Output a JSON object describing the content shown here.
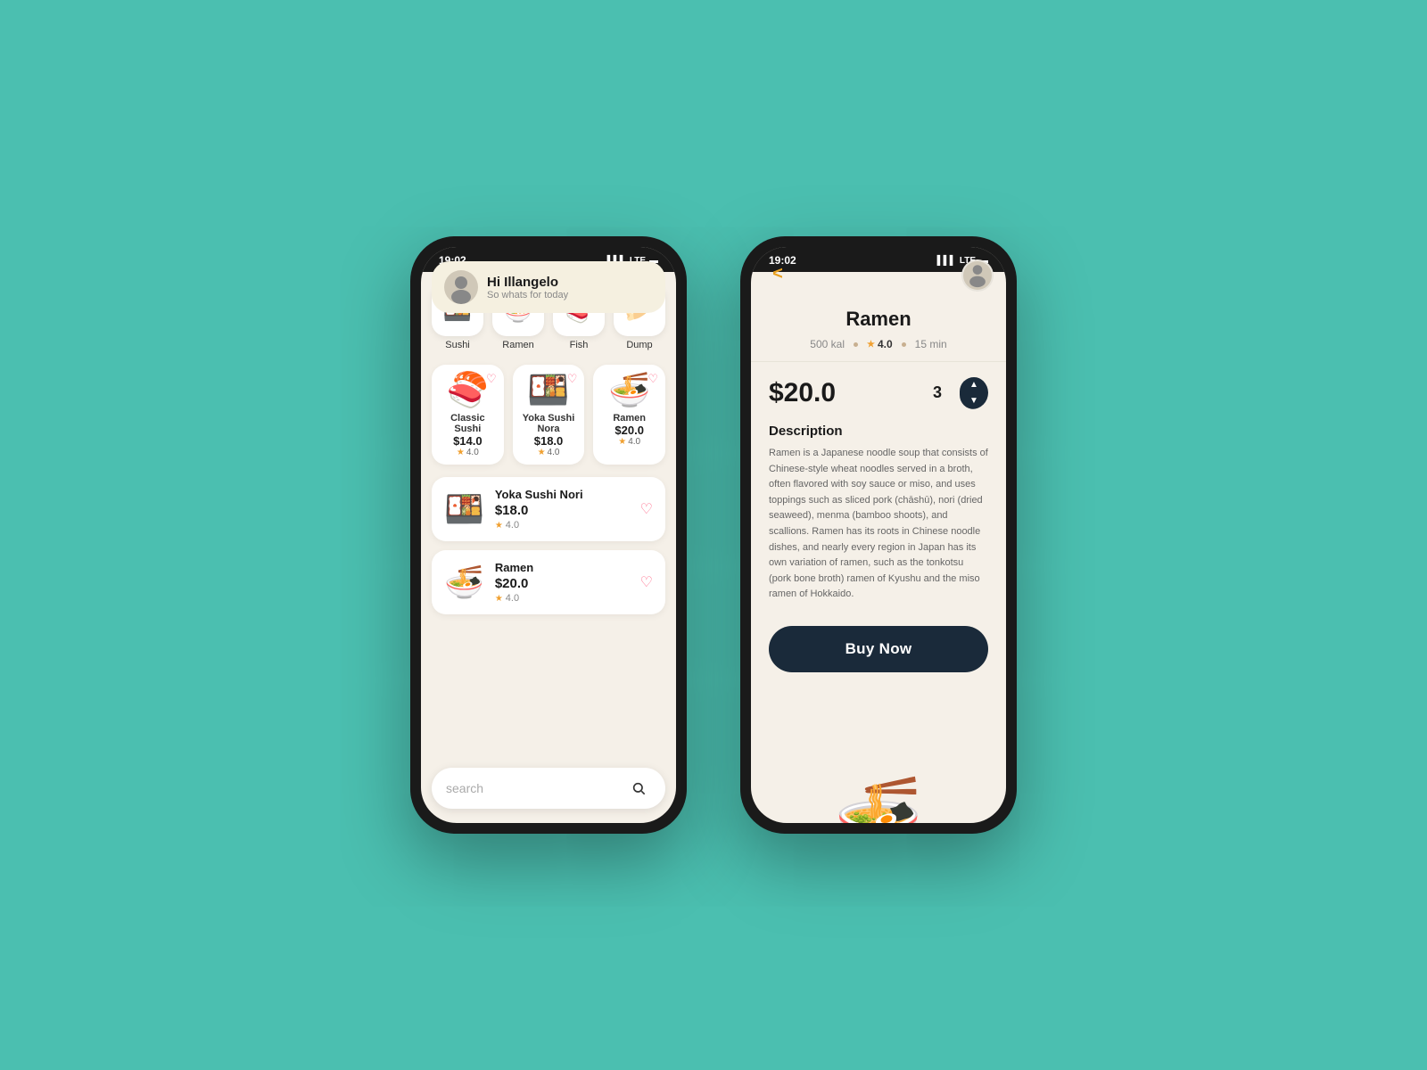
{
  "background_color": "#4BBFB0",
  "phone1": {
    "status_bar": {
      "time": "19:02",
      "signal": "▌▌▌",
      "network": "LTE",
      "battery": "🔋"
    },
    "greeting": {
      "title": "Hi Illangelo",
      "subtitle": "So whats for today"
    },
    "search": {
      "placeholder": "search"
    },
    "categories": [
      {
        "label": "Sushi",
        "emoji": "🍱"
      },
      {
        "label": "Ramen",
        "emoji": "🍜"
      },
      {
        "label": "Fish",
        "emoji": "🍣"
      },
      {
        "label": "Dump",
        "emoji": "🥟"
      }
    ],
    "featured_items": [
      {
        "name": "Classic Sushi",
        "price": "$14.0",
        "rating": "4.0",
        "emoji": "🍣"
      },
      {
        "name": "Yoka Sushi Nora",
        "price": "$18.0",
        "rating": "4.0",
        "emoji": "🍱"
      },
      {
        "name": "Ramen",
        "price": "$20.0",
        "rating": "4.0",
        "emoji": "🍜"
      }
    ],
    "list_items": [
      {
        "name": "Yoka Sushi Nori",
        "price": "$18.0",
        "rating": "4.0",
        "emoji": "🍱"
      },
      {
        "name": "Ramen",
        "price": "$20.0",
        "rating": "4.0",
        "emoji": "🍜"
      }
    ]
  },
  "phone2": {
    "status_bar": {
      "time": "19:02",
      "signal": "▌▌▌",
      "network": "LTE",
      "battery": "🔋"
    },
    "item": {
      "name": "Ramen",
      "emoji": "🍜",
      "calories": "500 kal",
      "rating": "4.0",
      "time": "15 min",
      "price": "$20.0",
      "quantity": "3",
      "description_title": "Description",
      "description": "Ramen is a Japanese noodle soup that consists of Chinese-style wheat noodles served in a broth, often flavored with soy sauce or miso, and uses toppings such as sliced pork (chāshū), nori (dried seaweed), menma (bamboo shoots), and scallions. Ramen has its roots in Chinese noodle dishes, and nearly every region in Japan has its own variation of ramen, such as the tonkotsu (pork bone broth) ramen of Kyushu and the miso ramen of Hokkaido.",
      "buy_button": "Buy Now"
    }
  }
}
